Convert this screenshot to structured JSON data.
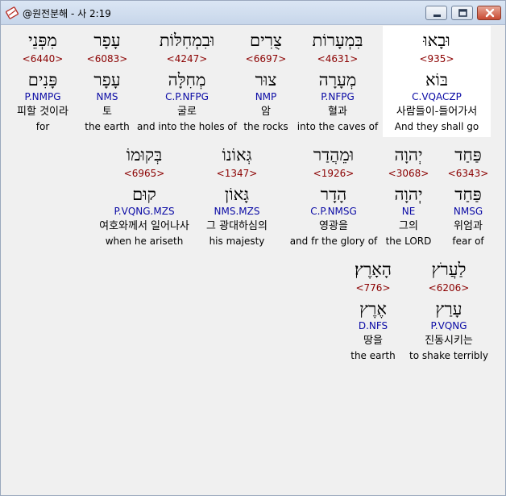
{
  "window": {
    "title": "@원전분해 - 사 2:19"
  },
  "colors": {
    "strong": "#8b0000",
    "morph": "#0a0aa5",
    "selected_bg": "#ffffff",
    "window_bg": "#f0f0f0"
  },
  "icons": {
    "app": "bible-book-icon",
    "minimize": "minimize-icon",
    "maximize": "maximize-icon",
    "close": "close-icon"
  },
  "words": [
    {
      "hebrew": "וּבָאוּ",
      "strong": "<935>",
      "lemma": "בּוֹא",
      "morph": "C.VQACZP",
      "korean": "사람들이-들어가서",
      "english": "And they shall go"
    },
    {
      "hebrew": "בִּמְעָרוֹת",
      "strong": "<4631>",
      "lemma": "מְעָרָה",
      "morph": "P.NFPG",
      "korean": "혈과",
      "english": "into the caves of"
    },
    {
      "hebrew": "צֻרִים",
      "strong": "<6697>",
      "lemma": "צוּר",
      "morph": "NMP",
      "korean": "암",
      "english": "the rocks"
    },
    {
      "hebrew": "וּבִמְחִלּוֹת",
      "strong": "<4247>",
      "lemma": "מְחִלָּה",
      "morph": "C.P.NFPG",
      "korean": "굴로",
      "english": "and into the holes of"
    },
    {
      "hebrew": "עָפָר",
      "strong": "<6083>",
      "lemma": "עָפָר",
      "morph": "NMS",
      "korean": "토",
      "english": "the earth"
    },
    {
      "hebrew": "מִפְּנֵי",
      "strong": "<6440>",
      "lemma": "פָּנִים",
      "morph": "P.NMPG",
      "korean": "피할 것이라",
      "english": "for"
    },
    {
      "hebrew": "פַּחַד",
      "strong": "<6343>",
      "lemma": "פַּחַד",
      "morph": "NMSG",
      "korean": "위엄과",
      "english": "fear of"
    },
    {
      "hebrew": "יְהוָה",
      "strong": "<3068>",
      "lemma": "יְהוָה",
      "morph": "NE",
      "korean": "그의",
      "english": "the LORD"
    },
    {
      "hebrew": "וּמֵהֲדַר",
      "strong": "<1926>",
      "lemma": "הָדָר",
      "morph": "C.P.NMSG",
      "korean": "영광을",
      "english": "and fr the glory of"
    },
    {
      "hebrew": "גְּאוֹנוֹ",
      "strong": "<1347>",
      "lemma": "גָּאוֹן",
      "morph": "NMS.MZS",
      "korean": "그 광대하심의",
      "english": "his majesty"
    },
    {
      "hebrew": "בְּקוּמוֹ",
      "strong": "<6965>",
      "lemma": "קוּם",
      "morph": "P.VQNG.MZS",
      "korean": "여호와께서 일어나사",
      "english": "when he ariseth"
    },
    {
      "hebrew": "לַעֲרֹץ",
      "strong": "<6206>",
      "lemma": "עָרַץ",
      "morph": "P.VQNG",
      "korean": "진동시키는",
      "english": "to shake terribly"
    },
    {
      "hebrew": "הָאָרֶץ׃",
      "strong": "<776>",
      "lemma": "אֶרֶץ",
      "morph": "D.NFS",
      "korean": "땅을",
      "english": "the earth"
    }
  ]
}
